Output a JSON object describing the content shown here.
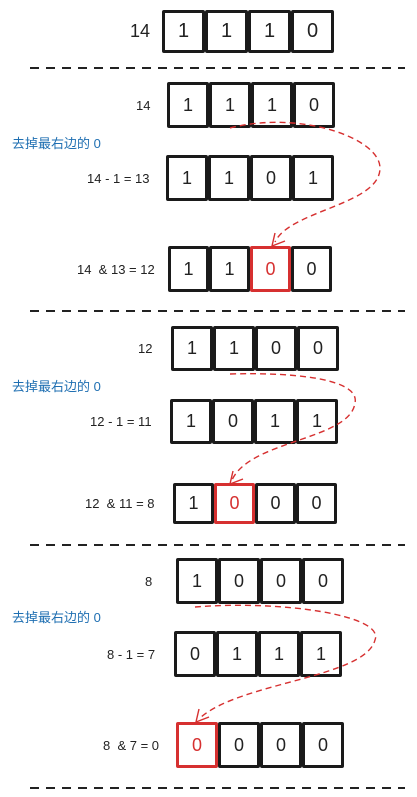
{
  "colors": {
    "ink": "#1a1a1a",
    "highlight": "#d63030",
    "note": "#1f6fb2"
  },
  "header": {
    "label": "14",
    "bits": [
      "1",
      "1",
      "1",
      "0"
    ]
  },
  "blocks": [
    {
      "note": "去掉最右边的 0",
      "rows": [
        {
          "label": "14",
          "bits": [
            "1",
            "1",
            "1",
            "0"
          ],
          "highlight": -1
        },
        {
          "label": "14 - 1 = 13",
          "bits": [
            "1",
            "1",
            "0",
            "1"
          ],
          "highlight": -1
        },
        {
          "label": "14  & 13 = 12",
          "bits": [
            "1",
            "1",
            "0",
            "0"
          ],
          "highlight": 2
        }
      ]
    },
    {
      "note": "去掉最右边的 0",
      "rows": [
        {
          "label": "12",
          "bits": [
            "1",
            "1",
            "0",
            "0"
          ],
          "highlight": -1
        },
        {
          "label": "12 - 1 = 11",
          "bits": [
            "1",
            "0",
            "1",
            "1"
          ],
          "highlight": -1
        },
        {
          "label": "12  & 11 = 8",
          "bits": [
            "1",
            "0",
            "0",
            "0"
          ],
          "highlight": 1
        }
      ]
    },
    {
      "note": "去掉最右边的 0",
      "rows": [
        {
          "label": "8",
          "bits": [
            "1",
            "0",
            "0",
            "0"
          ],
          "highlight": -1
        },
        {
          "label": "8 - 1 = 7",
          "bits": [
            "0",
            "1",
            "1",
            "1"
          ],
          "highlight": -1
        },
        {
          "label": "8  & 7 = 0",
          "bits": [
            "0",
            "0",
            "0",
            "0"
          ],
          "highlight": 0
        }
      ]
    }
  ]
}
